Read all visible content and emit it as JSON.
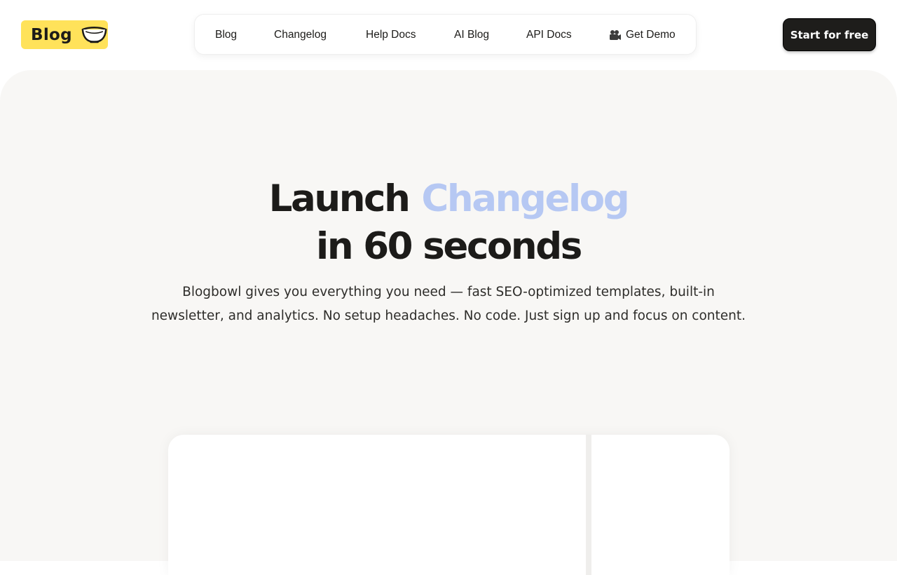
{
  "header": {
    "logo_text": "Blog",
    "logo_icon": "bowl-icon",
    "nav": [
      {
        "label": "Blog"
      },
      {
        "label": "Changelog"
      },
      {
        "label": "Help Docs"
      },
      {
        "label": "AI Blog"
      },
      {
        "label": "API Docs"
      },
      {
        "label": "Get Demo",
        "icon": "video-camera-icon"
      }
    ],
    "cta_label": "Start for free"
  },
  "hero": {
    "headline_part1": "Launch",
    "headline_accent": "Changelog",
    "headline_part2": "in 60 seconds",
    "subtitle_line1": "Blogbowl gives you everything you need — fast SEO-optimized templates, built-in",
    "subtitle_line2": "newsletter, and analytics. No setup headaches. No code. Just sign up and focus on content."
  },
  "colors": {
    "logo_bg": "#ffe25a",
    "accent_text": "#b6c8f3",
    "hero_bg": "#f8f7f5",
    "cta_bg": "#1e1d1b"
  }
}
